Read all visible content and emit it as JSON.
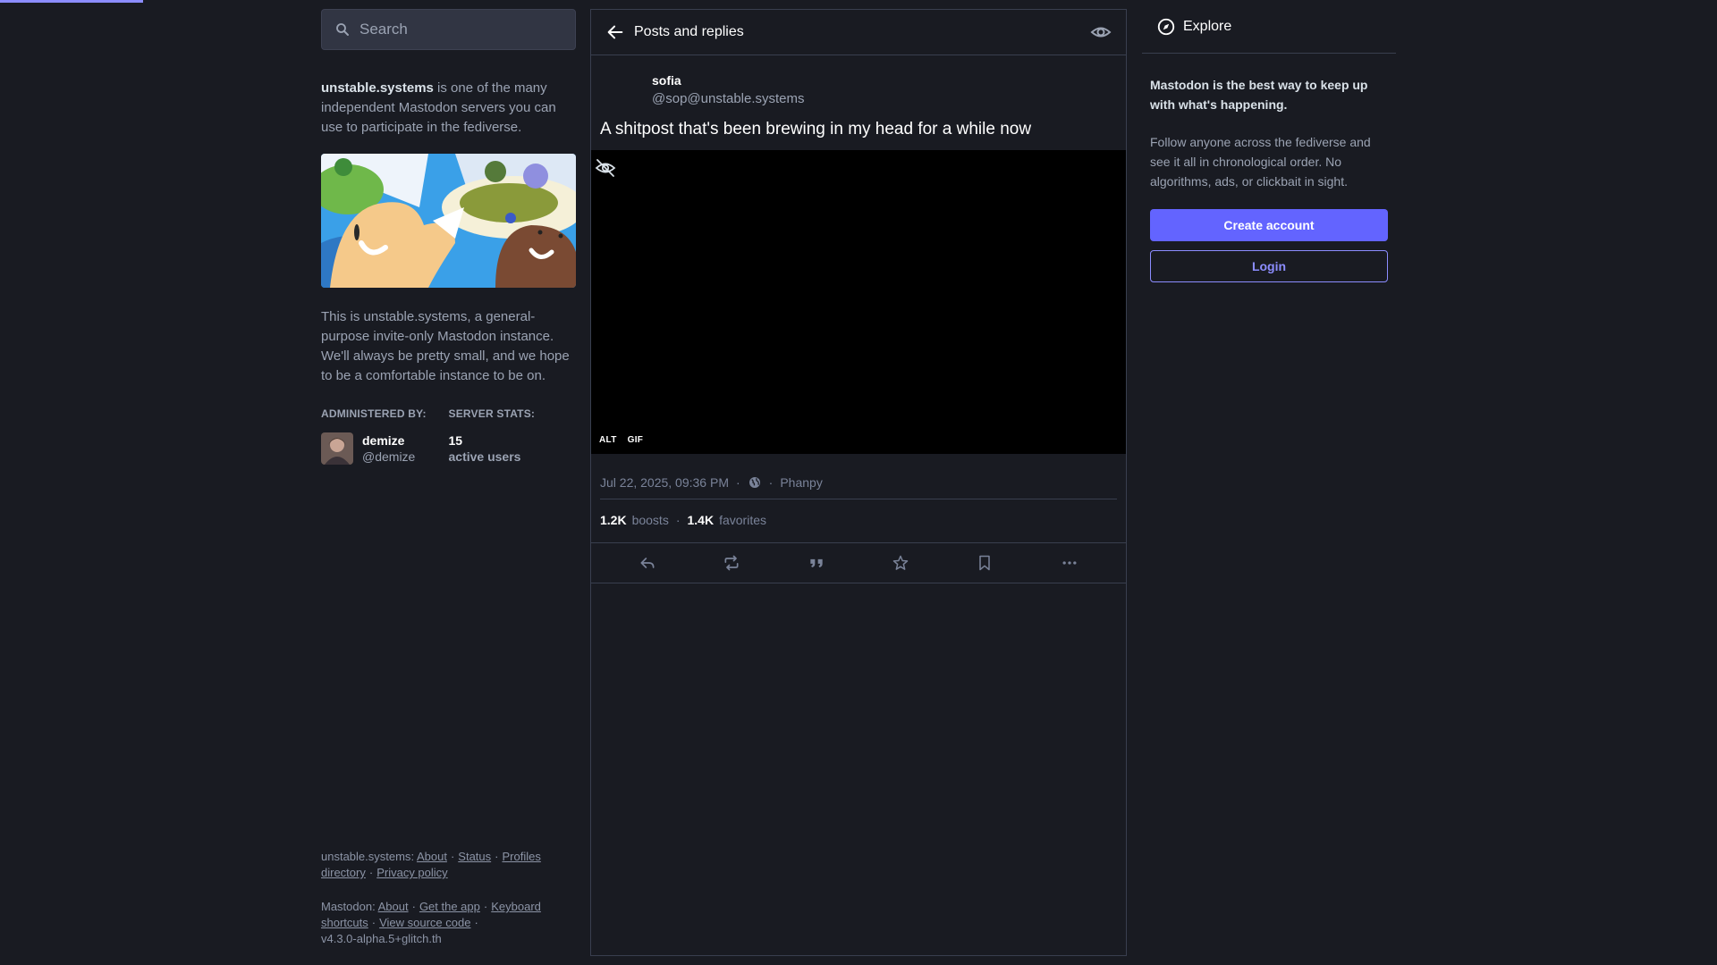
{
  "search": {
    "placeholder": "Search"
  },
  "server": {
    "domain": "unstable.systems",
    "intro_rest": " is one of the many independent Mastodon servers you can use to participate in the fediverse.",
    "description": "This is unstable.systems, a general-purpose invite-only Mastodon instance. We'll always be pretty small, and we hope to be a comfortable instance to be on.",
    "administered_by_label": "ADMINISTERED BY:",
    "server_stats_label": "SERVER STATS:",
    "admin": {
      "display_name": "demize",
      "handle": "@demize"
    },
    "stats": {
      "active_users": "15",
      "active_users_label": "active users"
    }
  },
  "footer": {
    "server_name": "unstable.systems",
    "server_links": [
      "About",
      "Status",
      "Profiles directory",
      "Privacy policy"
    ],
    "mastodon_name": "Mastodon",
    "mastodon_links": [
      "About",
      "Get the app",
      "Keyboard shortcuts",
      "View source code"
    ],
    "version": "v4.3.0-alpha.5+glitch.th"
  },
  "column": {
    "title": "Posts and replies"
  },
  "post": {
    "display_name": "sofia",
    "acct": "@sop@unstable.systems",
    "content": "A shitpost that's been brewing in my head for a while now",
    "media_badges": [
      "ALT",
      "GIF"
    ],
    "timestamp": "Jul 22, 2025, 09:36 PM",
    "application": "Phanpy",
    "boosts_count": "1.2K",
    "boosts_label": "boosts",
    "favorites_count": "1.4K",
    "favorites_label": "favorites"
  },
  "explore": {
    "label": "Explore"
  },
  "promo": {
    "headline": "Mastodon is the best way to keep up with what's happening.",
    "body": "Follow anyone across the fediverse and see it all in chronological order. No algorithms, ads, or clickbait in sight.",
    "create_account": "Create account",
    "login": "Login"
  },
  "colors": {
    "accent": "#6364ff",
    "accent_light": "#8c8dff",
    "background": "#191b22"
  }
}
